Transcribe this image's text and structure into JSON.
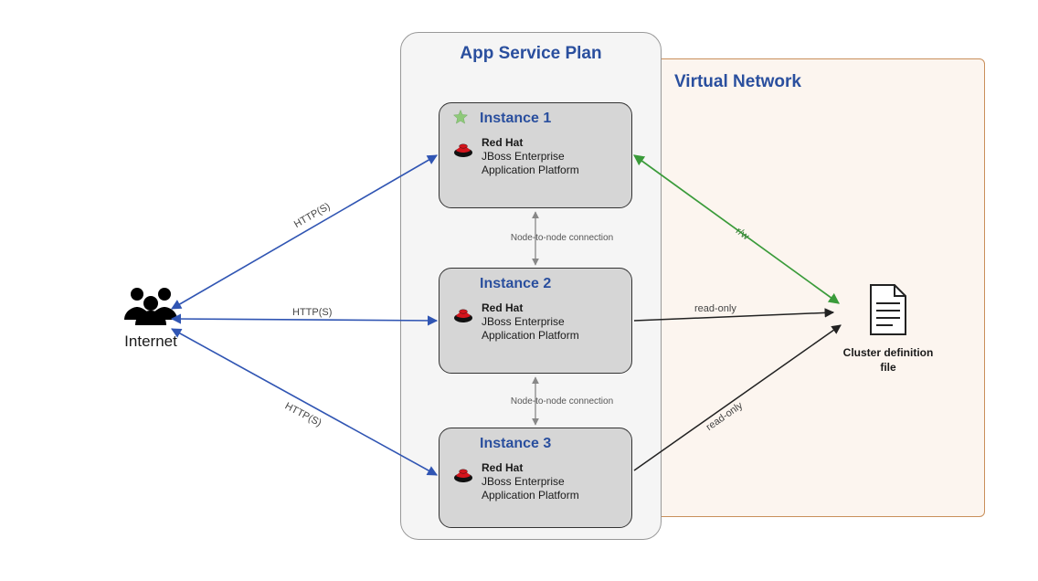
{
  "internet": {
    "label": "Internet"
  },
  "containers": {
    "app_service_plan": {
      "title": "App Service Plan"
    },
    "virtual_network": {
      "title": "Virtual Network"
    }
  },
  "instances": [
    {
      "name": "Instance 1",
      "starred": true,
      "brand": "Red Hat",
      "product_line1": "JBoss Enterprise",
      "product_line2": "Application Platform"
    },
    {
      "name": "Instance 2",
      "starred": false,
      "brand": "Red Hat",
      "product_line1": "JBoss Enterprise",
      "product_line2": "Application Platform"
    },
    {
      "name": "Instance 3",
      "starred": false,
      "brand": "Red Hat",
      "product_line1": "JBoss Enterprise",
      "product_line2": "Application Platform"
    }
  ],
  "cluster_file": {
    "label_line1": "Cluster definition",
    "label_line2": "file"
  },
  "edges": {
    "http1": "HTTP(S)",
    "http2": "HTTP(S)",
    "http3": "HTTP(S)",
    "node_conn1": "Node-to-node connection",
    "node_conn2": "Node-to-node connection",
    "rw": "r/w",
    "readonly1": "read-only",
    "readonly2": "read-only"
  },
  "colors": {
    "title_blue": "#2a4f9e",
    "arrow_blue": "#3055b3",
    "rw_green": "#3a9b3a",
    "vnet_border": "#c98f5a",
    "vnet_fill": "rgba(248,233,219,0.45)",
    "instance_fill": "#d6d6d6"
  }
}
